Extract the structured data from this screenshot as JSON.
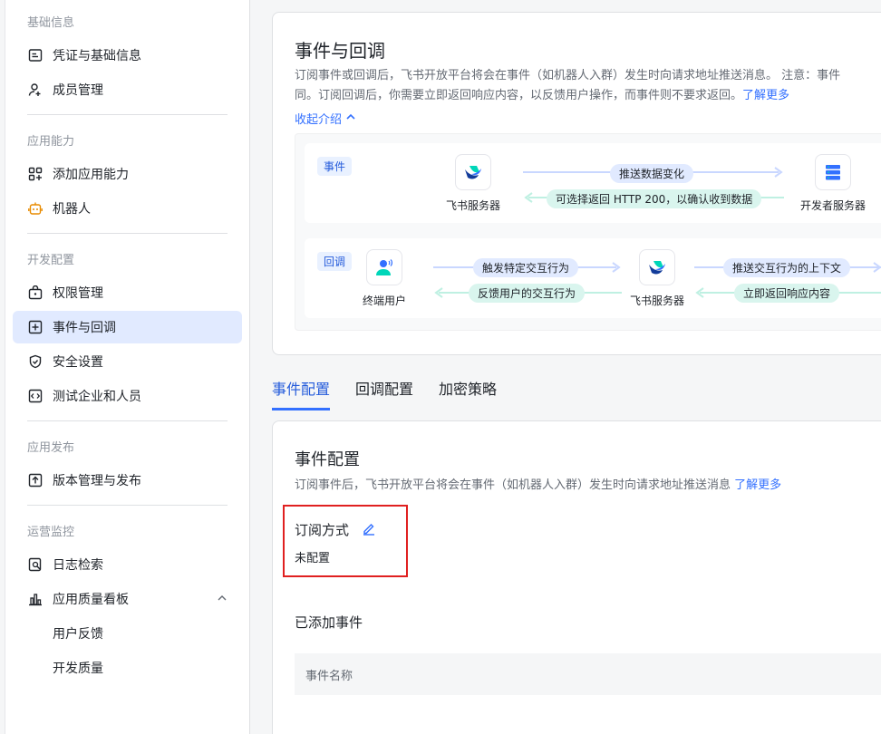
{
  "sidebar": {
    "groups": [
      {
        "title": "基础信息",
        "items": [
          {
            "label": "凭证与基础信息",
            "icon": "id-card-icon"
          },
          {
            "label": "成员管理",
            "icon": "user-add-icon"
          }
        ]
      },
      {
        "title": "应用能力",
        "items": [
          {
            "label": "添加应用能力",
            "icon": "grid-add-icon"
          },
          {
            "label": "机器人",
            "icon": "robot-icon"
          }
        ]
      },
      {
        "title": "开发配置",
        "items": [
          {
            "label": "权限管理",
            "icon": "lock-box-icon"
          },
          {
            "label": "事件与回调",
            "icon": "event-plus-icon"
          },
          {
            "label": "安全设置",
            "icon": "shield-icon"
          },
          {
            "label": "测试企业和人员",
            "icon": "code-box-icon"
          }
        ]
      },
      {
        "title": "应用发布",
        "items": [
          {
            "label": "版本管理与发布",
            "icon": "upload-box-icon"
          }
        ]
      },
      {
        "title": "运营监控",
        "items": [
          {
            "label": "日志检索",
            "icon": "log-search-icon"
          },
          {
            "label": "应用质量看板",
            "icon": "bar-chart-icon"
          },
          {
            "label": "用户反馈"
          },
          {
            "label": "开发质量"
          }
        ]
      }
    ]
  },
  "intro": {
    "title": "事件与回调",
    "desc_line1": "订阅事件或回调后，飞书开放平台将会在事件（如机器人入群）发生时向请求地址推送消息。 注意：事件",
    "desc_line2": "同。订阅回调后，你需要立即返回响应内容，以反馈用户操作，而事件则不要求返回。",
    "learn_more": "了解更多",
    "collapse": "收起介绍"
  },
  "flow": {
    "event_tag": "事件",
    "callback_tag": "回调",
    "feishu_server": "飞书服务器",
    "dev_server": "开发者服务器",
    "end_user": "终端用户",
    "push_change": "推送数据变化",
    "optional_return": "可选择返回 HTTP 200，以确认收到数据",
    "trigger": "触发特定交互行为",
    "feedback": "反馈用户的交互行为",
    "push_context": "推送交互行为的上下文",
    "return_now": "立即返回响应内容"
  },
  "tabs": [
    "事件配置",
    "回调配置",
    "加密策略"
  ],
  "config": {
    "title": "事件配置",
    "desc": "订阅事件后，飞书开放平台将会在事件（如机器人入群）发生时向请求地址推送消息",
    "learn_more": "了解更多",
    "sub_mode_label": "订阅方式",
    "sub_mode_value": "未配置",
    "added_events": "已添加事件",
    "col_event_name": "事件名称"
  },
  "colors": {
    "accent": "#3370ff",
    "active_bg": "#e1eaff",
    "highlight": "#e02020"
  }
}
